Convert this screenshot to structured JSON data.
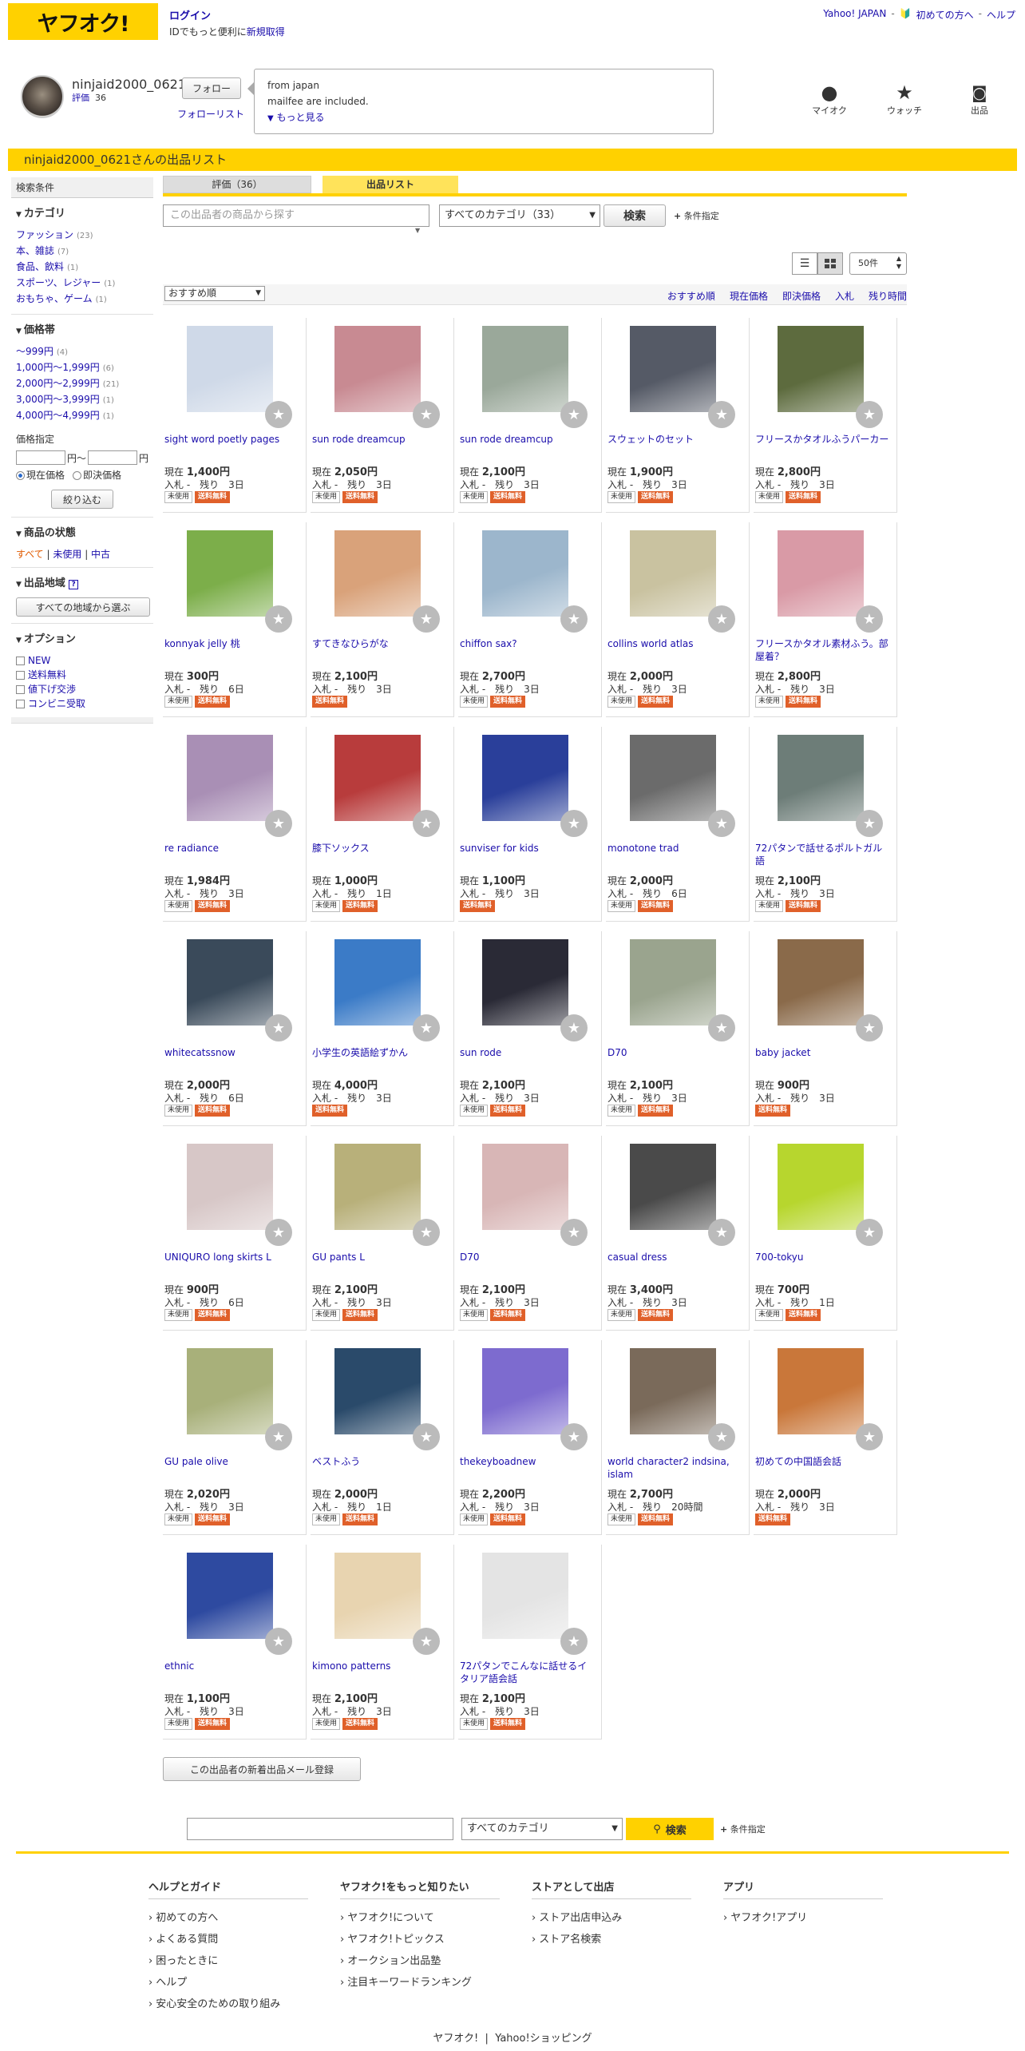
{
  "header": {
    "logo": "ヤフオク!",
    "login": "ログイン",
    "login_sub_a": "IDでもっと便利に",
    "login_sub_b": "新規取得",
    "links": [
      "Yahoo! JAPAN",
      "初めての方へ",
      "ヘルプ"
    ]
  },
  "seller": {
    "name": "ninjaid2000_0621",
    "eval_label": "評価",
    "eval_count": "36",
    "follow": "フォロー",
    "follow_list": "フォローリスト",
    "bubble_line1": "from japan",
    "bubble_line2": "mailfee are included.",
    "bubble_more": "もっと見る"
  },
  "top_icons": [
    {
      "label": "マイオク",
      "icon": "person-icon",
      "glyph": "●"
    },
    {
      "label": "ウォッチ",
      "icon": "star-icon",
      "glyph": "★"
    },
    {
      "label": "出品",
      "icon": "camera-icon",
      "glyph": "📷"
    }
  ],
  "page_title": "ninjaid2000_0621さんの出品リスト",
  "sidebar": {
    "cond": "検索条件",
    "category_title": "カテゴリ",
    "categories": [
      {
        "name": "ファッション",
        "count": "(23)"
      },
      {
        "name": "本、雑誌",
        "count": "(7)"
      },
      {
        "name": "食品、飲料",
        "count": "(1)"
      },
      {
        "name": "スポーツ、レジャー",
        "count": "(1)"
      },
      {
        "name": "おもちゃ、ゲーム",
        "count": "(1)"
      }
    ],
    "price_title": "価格帯",
    "prices": [
      {
        "name": "〜999円",
        "count": "(4)"
      },
      {
        "name": "1,000円〜1,999円",
        "count": "(6)"
      },
      {
        "name": "2,000円〜2,999円",
        "count": "(21)"
      },
      {
        "name": "3,000円〜3,999円",
        "count": "(1)"
      },
      {
        "name": "4,000円〜4,999円",
        "count": "(1)"
      }
    ],
    "price_spec": "価格指定",
    "yen1": "円〜",
    "yen2": "円",
    "radio1": "現在価格",
    "radio2": "即決価格",
    "narrow": "絞り込む",
    "state_title": "商品の状態",
    "state_all": "すべて",
    "state_unused": "未使用",
    "state_used": "中古",
    "region_title": "出品地域",
    "region_btn": "すべての地域から選ぶ",
    "option_title": "オプション",
    "options": [
      "NEW",
      "送料無料",
      "値下げ交渉",
      "コンビニ受取"
    ]
  },
  "tabs": {
    "eval": "評価（36）",
    "list": "出品リスト"
  },
  "search": {
    "placeholder": "この出品者の商品から探す",
    "category": "すべてのカテゴリ（33）",
    "button": "検索",
    "cond": "条件指定"
  },
  "perpage": "50件",
  "sort": {
    "select": "おすすめ順",
    "links": [
      "おすすめ順",
      "現在価格",
      "即決価格",
      "入札",
      "残り時間"
    ]
  },
  "labels": {
    "now": "現在",
    "bid": "入札 -　残り",
    "unused": "未使用",
    "free": "送料無料"
  },
  "items": [
    {
      "title": "sight word poetly pages",
      "price": "1,400円",
      "left": "3日",
      "unused": true,
      "free": true,
      "color": "#cfd9e8"
    },
    {
      "title": "sun rode dreamcup",
      "price": "2,050円",
      "left": "3日",
      "unused": true,
      "free": true,
      "color": "#c88a92"
    },
    {
      "title": "sun rode dreamcup",
      "price": "2,100円",
      "left": "3日",
      "unused": true,
      "free": true,
      "color": "#9aa89a"
    },
    {
      "title": "スウェットのセット",
      "price": "1,900円",
      "left": "3日",
      "unused": true,
      "free": true,
      "color": "#555a66"
    },
    {
      "title": "フリースかタオルふうパーカー",
      "price": "2,800円",
      "left": "3日",
      "unused": true,
      "free": true,
      "color": "#5d6b3e"
    },
    {
      "title": "konnyak jelly 桃",
      "price": "300円",
      "left": "6日",
      "unused": true,
      "free": true,
      "color": "#7cae4a"
    },
    {
      "title": "すてきなひらがな",
      "price": "2,100円",
      "left": "3日",
      "unused": false,
      "free": true,
      "color": "#d9a27a"
    },
    {
      "title": "chiffon sax?",
      "price": "2,700円",
      "left": "3日",
      "unused": true,
      "free": true,
      "color": "#9cb6cc"
    },
    {
      "title": "collins world atlas",
      "price": "2,000円",
      "left": "3日",
      "unused": true,
      "free": true,
      "color": "#c9c2a0"
    },
    {
      "title": "フリースかタオル素材ふう。部屋着？",
      "price": "2,800円",
      "left": "3日",
      "unused": true,
      "free": true,
      "color": "#d99aa6"
    },
    {
      "title": "re radiance",
      "price": "1,984円",
      "left": "3日",
      "unused": true,
      "free": true,
      "color": "#a98fb5"
    },
    {
      "title": "膝下ソックス",
      "price": "1,000円",
      "left": "1日",
      "unused": true,
      "free": true,
      "color": "#b83c3c"
    },
    {
      "title": "sunviser for kids",
      "price": "1,100円",
      "left": "3日",
      "unused": false,
      "free": true,
      "color": "#2a3f9a"
    },
    {
      "title": "monotone trad",
      "price": "2,000円",
      "left": "6日",
      "unused": true,
      "free": true,
      "color": "#6b6b6b"
    },
    {
      "title": "72パタンで話せるポルトガル語",
      "price": "2,100円",
      "left": "3日",
      "unused": true,
      "free": true,
      "color": "#6d7d78"
    },
    {
      "title": "whitecatssnow",
      "price": "2,000円",
      "left": "6日",
      "unused": true,
      "free": true,
      "color": "#3a4a5a"
    },
    {
      "title": "小学生の英語絵ずかん",
      "price": "4,000円",
      "left": "3日",
      "unused": false,
      "free": true,
      "color": "#3b7bc7"
    },
    {
      "title": "sun rode",
      "price": "2,100円",
      "left": "3日",
      "unused": true,
      "free": true,
      "color": "#2a2a36"
    },
    {
      "title": "D70",
      "price": "2,100円",
      "left": "3日",
      "unused": true,
      "free": true,
      "color": "#9aa48e"
    },
    {
      "title": "baby jacket",
      "price": "900円",
      "left": "3日",
      "unused": false,
      "free": true,
      "color": "#8a6a4a"
    },
    {
      "title": "UNIQURO long skirts L",
      "price": "900円",
      "left": "6日",
      "unused": true,
      "free": true,
      "color": "#d7c7c7"
    },
    {
      "title": "GU pants L",
      "price": "2,100円",
      "left": "3日",
      "unused": true,
      "free": true,
      "color": "#b8b07a"
    },
    {
      "title": "D70",
      "price": "2,100円",
      "left": "3日",
      "unused": true,
      "free": true,
      "color": "#d8b6b6"
    },
    {
      "title": "casual dress",
      "price": "3,400円",
      "left": "3日",
      "unused": true,
      "free": true,
      "color": "#4a4a4a"
    },
    {
      "title": "700-tokyu",
      "price": "700円",
      "left": "1日",
      "unused": true,
      "free": true,
      "color": "#b7d62e"
    },
    {
      "title": "GU pale olive",
      "price": "2,020円",
      "left": "3日",
      "unused": true,
      "free": true,
      "color": "#a8b07a"
    },
    {
      "title": "ベストふう",
      "price": "2,000円",
      "left": "1日",
      "unused": true,
      "free": true,
      "color": "#2a4a6a"
    },
    {
      "title": "thekeyboadnew",
      "price": "2,200円",
      "left": "3日",
      "unused": true,
      "free": true,
      "color": "#7d6bcf"
    },
    {
      "title": "world character2 indsina, islam",
      "price": "2,700円",
      "left": "20時間",
      "unused": true,
      "free": true,
      "color": "#7a6a5a"
    },
    {
      "title": "初めての中国語会話",
      "price": "2,000円",
      "left": "3日",
      "unused": false,
      "free": true,
      "color": "#c9773a"
    },
    {
      "title": "ethnic",
      "price": "1,100円",
      "left": "3日",
      "unused": true,
      "free": true,
      "color": "#2e4aa0"
    },
    {
      "title": "kimono patterns",
      "price": "2,100円",
      "left": "3日",
      "unused": true,
      "free": true,
      "color": "#e8d4b0"
    },
    {
      "title": "72パタンでこんなに話せるイタリア語会話",
      "price": "2,100円",
      "left": "3日",
      "unused": true,
      "free": true,
      "color": "#e4e4e4"
    }
  ],
  "mail_button": "この出品者の新着出品メール登録",
  "bottom_search": {
    "category": "すべてのカテゴリ",
    "button": "検索",
    "cond": "条件指定"
  },
  "footer": {
    "cols": [
      {
        "title": "ヘルプとガイド",
        "items": [
          "初めての方へ",
          "よくある質問",
          "困ったときに",
          "ヘルプ",
          "安心安全のための取り組み"
        ]
      },
      {
        "title": "ヤフオク!をもっと知りたい",
        "items": [
          "ヤフオク!について",
          "ヤフオク!トピックス",
          "オークション出品塾",
          "注目キーワードランキング"
        ]
      },
      {
        "title": "ストアとして出店",
        "items": [
          "ストア出店申込み",
          "ストア名検索"
        ]
      },
      {
        "title": "アプリ",
        "items": [
          "ヤフオク!アプリ"
        ]
      }
    ],
    "bottom": [
      "ヤフオク!",
      "Yahoo!ショッピング"
    ]
  }
}
